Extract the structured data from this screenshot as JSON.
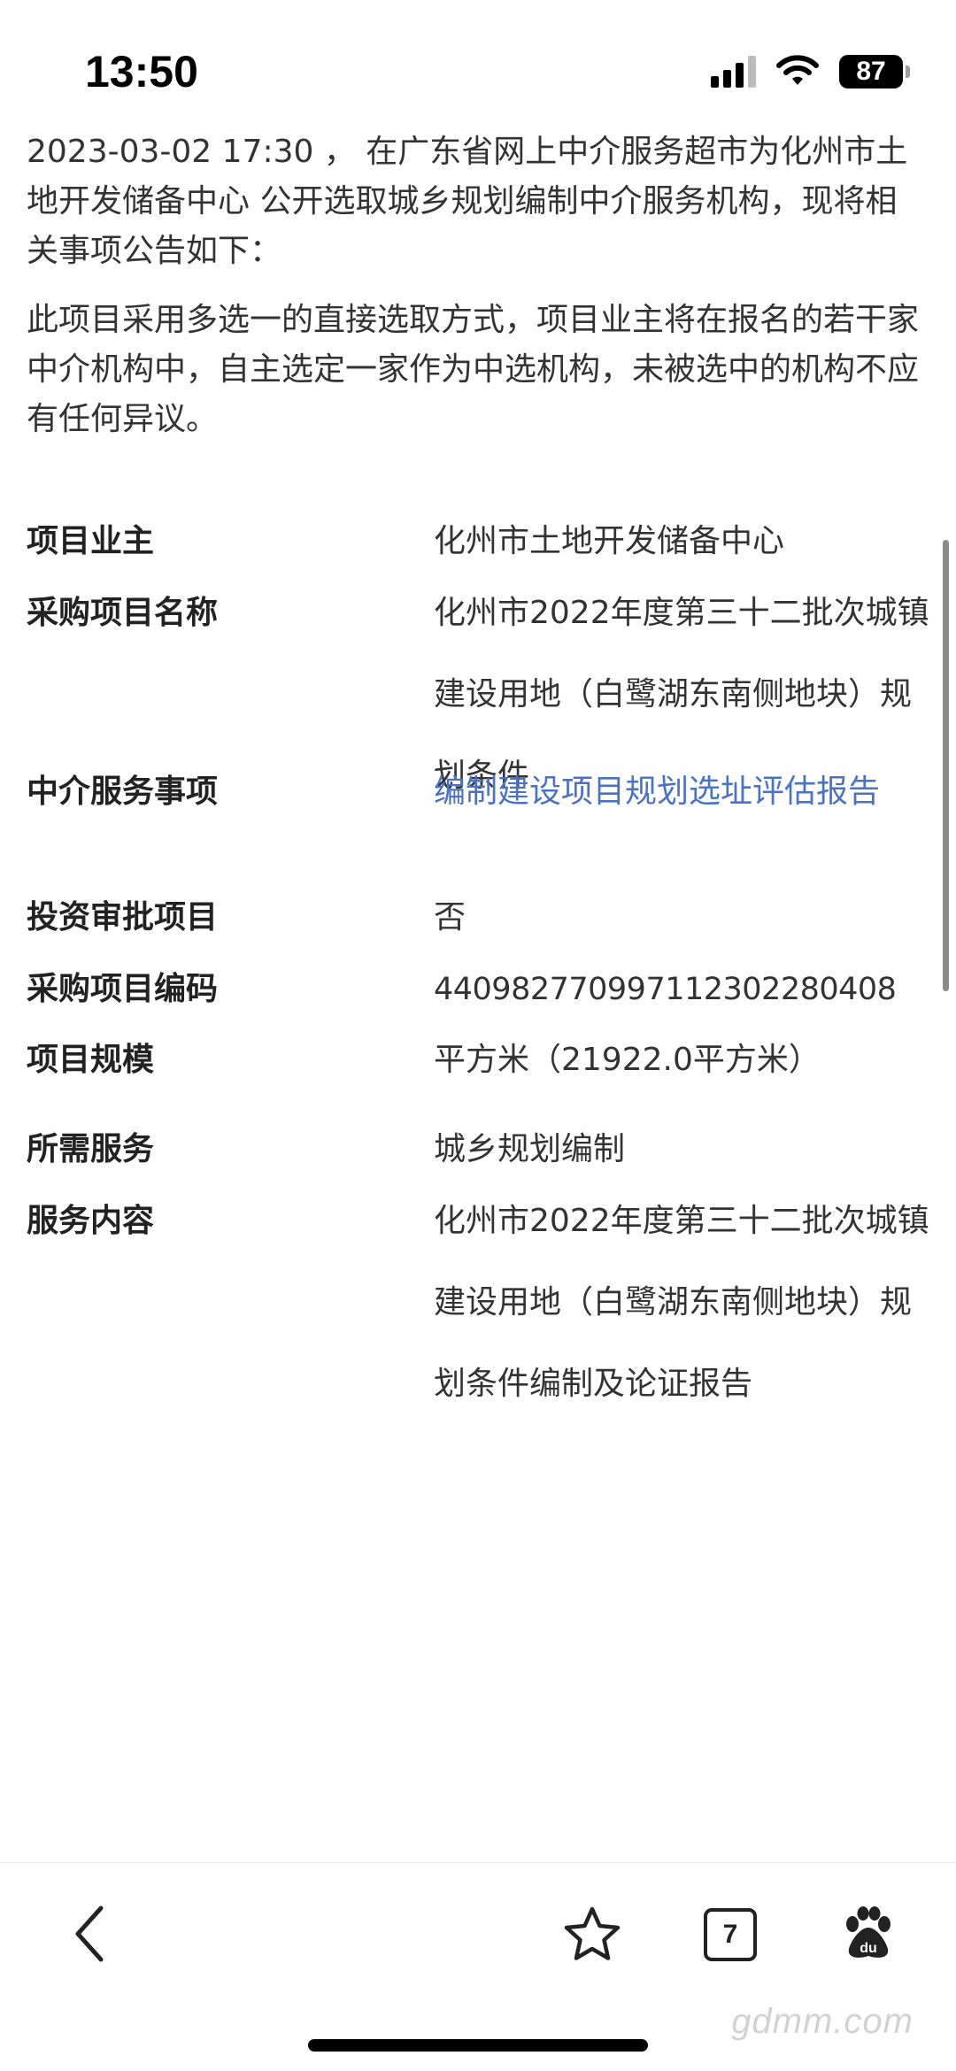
{
  "status_bar": {
    "time": "13:50",
    "battery": "87"
  },
  "intro": {
    "paragraph1": "2023-03-02 17:30 ， 在广东省网上中介服务超市为化州市土地开发储备中心 公开选取城乡规划编制中介服务机构，现将相关事项公告如下：",
    "paragraph2": "此项目采用多选一的直接选取方式，项目业主将在报名的若干家中介机构中，自主选定一家作为中选机构，未被选中的机构不应有任何异议。"
  },
  "details": [
    {
      "label": "项目业主",
      "value": "化州市土地开发储备中心"
    },
    {
      "label": "采购项目名称",
      "value": "化州市2022年度第三十二批次城镇建设用地（白鹭湖东南侧地块）规划条件"
    },
    {
      "label": "中介服务事项",
      "value": "编制建设项目规划选址评估报告"
    },
    {
      "label": "投资审批项目",
      "value": "否"
    },
    {
      "label": "采购项目编码",
      "value": "440982770997112302280408"
    },
    {
      "label": "项目规模",
      "value": "平方米（21922.0平方米）"
    },
    {
      "label": "所需服务",
      "value": "城乡规划编制"
    },
    {
      "label": "服务内容",
      "value": "化州市2022年度第三十二批次城镇建设用地（白鹭湖东南侧地块）规划条件编制及论证报告"
    }
  ],
  "nav": {
    "tabs_count": "7"
  },
  "watermark": "gdmm.com",
  "icons": [
    "signal-icon",
    "wifi-icon",
    "battery-icon",
    "back-icon",
    "star-icon",
    "tabs-icon",
    "baidu-paw-icon"
  ]
}
